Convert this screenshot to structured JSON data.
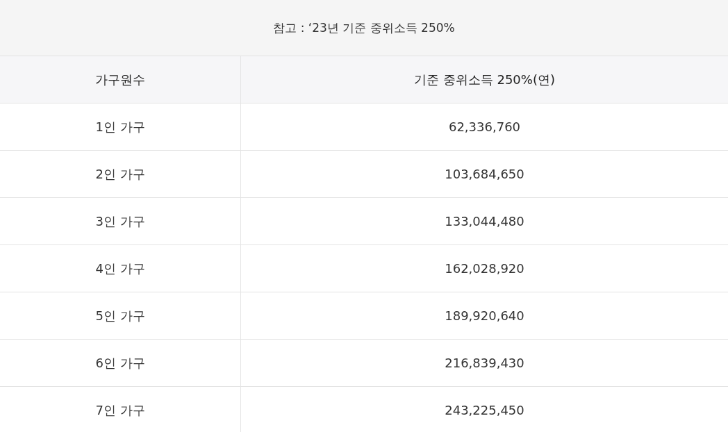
{
  "caption": "참고 : ‘23년 기준 중위소득 250%",
  "table": {
    "columns": [
      "가구원수",
      "기준 중위소득 250%(연)"
    ],
    "rows": [
      [
        "1인 가구",
        "62,336,760"
      ],
      [
        "2인 가구",
        "103,684,650"
      ],
      [
        "3인 가구",
        "133,044,480"
      ],
      [
        "4인 가구",
        "162,028,920"
      ],
      [
        "5인 가구",
        "189,920,640"
      ],
      [
        "6인 가구",
        "216,839,430"
      ],
      [
        "7인 가구",
        "243,225,450"
      ]
    ]
  }
}
